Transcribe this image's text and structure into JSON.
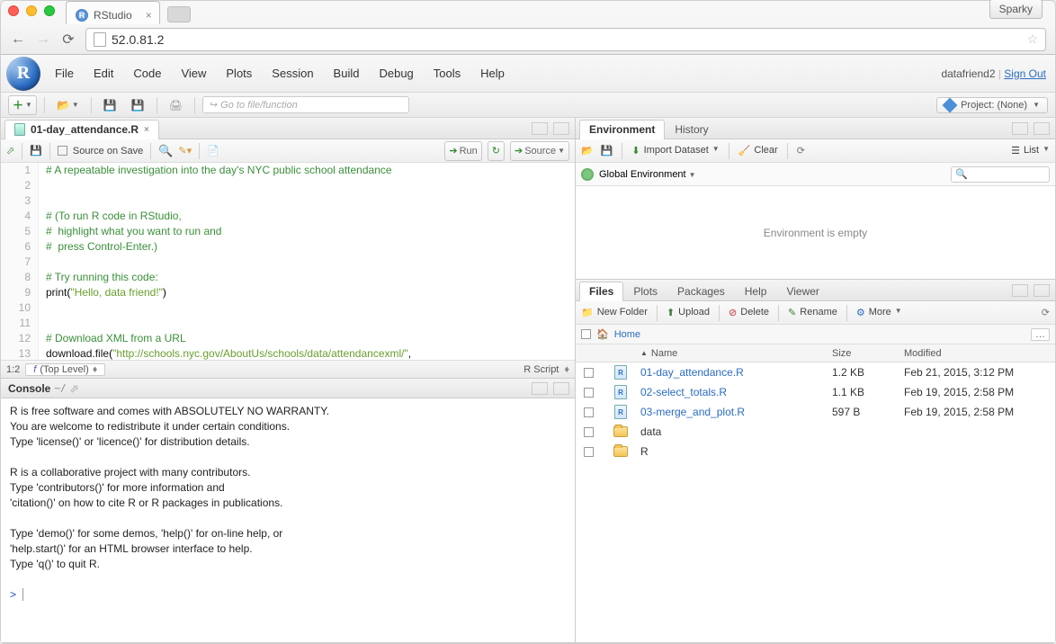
{
  "browser": {
    "tab_title": "RStudio",
    "sparky_label": "Sparky",
    "url": "52.0.81.2"
  },
  "menubar": {
    "items": [
      "File",
      "Edit",
      "Code",
      "View",
      "Plots",
      "Session",
      "Build",
      "Debug",
      "Tools",
      "Help"
    ],
    "username": "datafriend2",
    "signout": "Sign Out"
  },
  "toolbar": {
    "goto_placeholder": "Go to file/function",
    "project_label": "Project: (None)"
  },
  "source": {
    "tab_filename": "01-day_attendance.R",
    "save_on_source": "Source on Save",
    "run_label": "Run",
    "source_label": "Source",
    "lines": [
      {
        "n": "1",
        "html": "<span class='comment'># A repeatable investigation into the day's NYC public school attendance</span>"
      },
      {
        "n": "2",
        "html": ""
      },
      {
        "n": "3",
        "html": ""
      },
      {
        "n": "4",
        "html": "<span class='comment'># (To run R code in RStudio,</span>"
      },
      {
        "n": "5",
        "html": "<span class='comment'>#  highlight what you want to run and</span>"
      },
      {
        "n": "6",
        "html": "<span class='comment'>#  press Control-Enter.)</span>"
      },
      {
        "n": "7",
        "html": ""
      },
      {
        "n": "8",
        "html": "<span class='comment'># Try running this code:</span>"
      },
      {
        "n": "9",
        "html": "<span class='func'>print</span>(<span class='string'>\"Hello, data friend!\"</span>)"
      },
      {
        "n": "10",
        "html": ""
      },
      {
        "n": "11",
        "html": ""
      },
      {
        "n": "12",
        "html": "<span class='comment'># Download XML from a URL</span>"
      },
      {
        "n": "13",
        "html": "<span class='func'>download.file</span>(<span class='string'>\"http://schools.nyc.gov/AboutUs/schools/data/attendancexml/\"</span>,"
      }
    ],
    "cursor": "1:2",
    "scope": "(Top Level)",
    "lang": "R Script"
  },
  "console": {
    "title": "Console",
    "path": "~/",
    "body": "R is free software and comes with ABSOLUTELY NO WARRANTY.\nYou are welcome to redistribute it under certain conditions.\nType 'license()' or 'licence()' for distribution details.\n\nR is a collaborative project with many contributors.\nType 'contributors()' for more information and\n'citation()' on how to cite R or R packages in publications.\n\nType 'demo()' for some demos, 'help()' for on-line help, or\n'help.start()' for an HTML browser interface to help.\nType 'q()' to quit R.\n",
    "prompt": ">"
  },
  "env": {
    "tabs": [
      "Environment",
      "History"
    ],
    "import": "Import Dataset",
    "clear": "Clear",
    "view": "List",
    "scope": "Global Environment",
    "empty": "Environment is empty"
  },
  "files": {
    "tabs": [
      "Files",
      "Plots",
      "Packages",
      "Help",
      "Viewer"
    ],
    "new_folder": "New Folder",
    "upload": "Upload",
    "delete": "Delete",
    "rename": "Rename",
    "more": "More",
    "home": "Home",
    "headers": {
      "name": "Name",
      "size": "Size",
      "modified": "Modified"
    },
    "rows": [
      {
        "type": "r",
        "name": "01-day_attendance.R",
        "size": "1.2 KB",
        "mod": "Feb 21, 2015, 3:12 PM"
      },
      {
        "type": "r",
        "name": "02-select_totals.R",
        "size": "1.1 KB",
        "mod": "Feb 19, 2015, 2:58 PM"
      },
      {
        "type": "r",
        "name": "03-merge_and_plot.R",
        "size": "597 B",
        "mod": "Feb 19, 2015, 2:58 PM"
      },
      {
        "type": "folder",
        "name": "data",
        "size": "",
        "mod": ""
      },
      {
        "type": "folder",
        "name": "R",
        "size": "",
        "mod": ""
      }
    ]
  }
}
